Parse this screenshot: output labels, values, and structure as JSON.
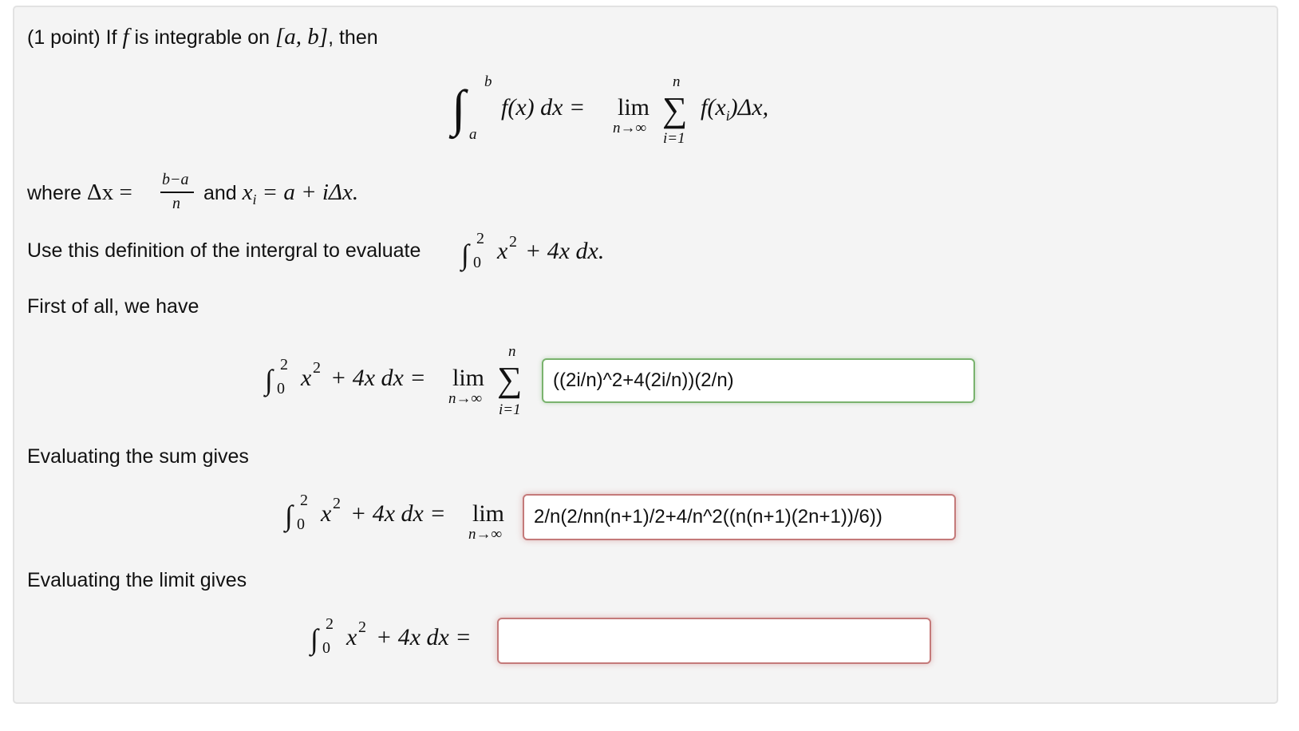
{
  "problem": {
    "intro_prefix": "(1 point) If ",
    "intro_f": "f",
    "intro_mid": " is integrable on ",
    "intro_interval": "[a, b]",
    "intro_suffix": ", then",
    "definition": {
      "integral_upper": "b",
      "integral_lower": "a",
      "integrand": "f(x) dx =",
      "lim": "lim",
      "lim_sub": "n→∞",
      "sum_upper": "n",
      "sum_lower": "i=1",
      "summand": "f(x",
      "summand_sub": "i",
      "summand_end": ")Δx,"
    },
    "where_label": "where ",
    "delta_x": "Δx =",
    "frac_num": "b−a",
    "frac_den": "n",
    "and_label": " and ",
    "xi": "x",
    "xi_sub": "i",
    "xi_def": "= a + iΔx.",
    "instruction": "Use this definition of the intergral to evaluate ",
    "target_upper": "2",
    "target_lower": "0",
    "target_integrand": "x",
    "target_exp": "2",
    "target_rest": "+ 4x dx.",
    "first_label": "First of all, we have",
    "sum_label": "Evaluating the sum gives",
    "limit_label": "Evaluating the limit gives"
  },
  "equations": {
    "lhs_upper": "2",
    "lhs_lower": "0",
    "lhs_x": "x",
    "lhs_exp": "2",
    "lhs_rest": "+ 4x dx =",
    "lim": "lim",
    "lim_sub": "n→∞",
    "sum_upper": "n",
    "sum_lower": "i=1"
  },
  "answers": [
    {
      "value": "((2i/n)^2+4(2i/n))(2/n)",
      "status": "correct",
      "status_color": "#7ab36e"
    },
    {
      "value": "2/n(2/nn(n+1)/2+4/n^2((n(n+1)(2n+1))/6))",
      "status": "incorrect",
      "status_color": "#c47a7a"
    },
    {
      "value": "",
      "status": "incorrect",
      "status_color": "#c47a7a"
    }
  ]
}
